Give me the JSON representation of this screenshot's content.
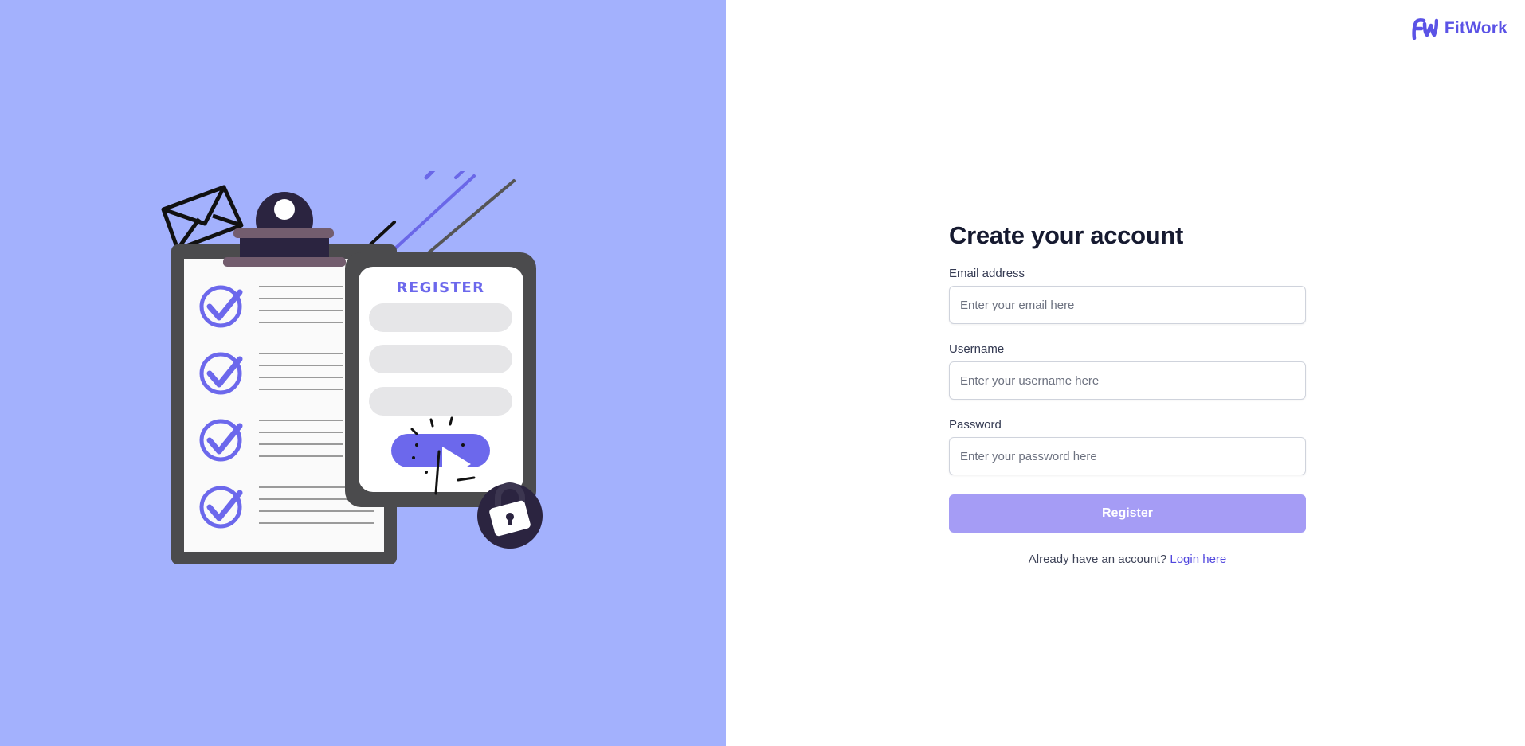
{
  "brand": {
    "name": "FitWork",
    "logo_icon": "fitwork-logo-icon",
    "color": "#5b53e6"
  },
  "illustration": {
    "register_heading": "REGISTER",
    "background_color": "#a3b1fd",
    "accent_color": "#6c68ec"
  },
  "form": {
    "title": "Create your account",
    "email": {
      "label": "Email address",
      "placeholder": "Enter your email here",
      "value": ""
    },
    "username": {
      "label": "Username",
      "placeholder": "Enter your username here",
      "value": ""
    },
    "password": {
      "label": "Password",
      "placeholder": "Enter your password here",
      "value": ""
    },
    "submit_label": "Register",
    "submit_color": "#a59cf5",
    "login_prompt": "Already have an account?",
    "login_link": "Login here"
  }
}
